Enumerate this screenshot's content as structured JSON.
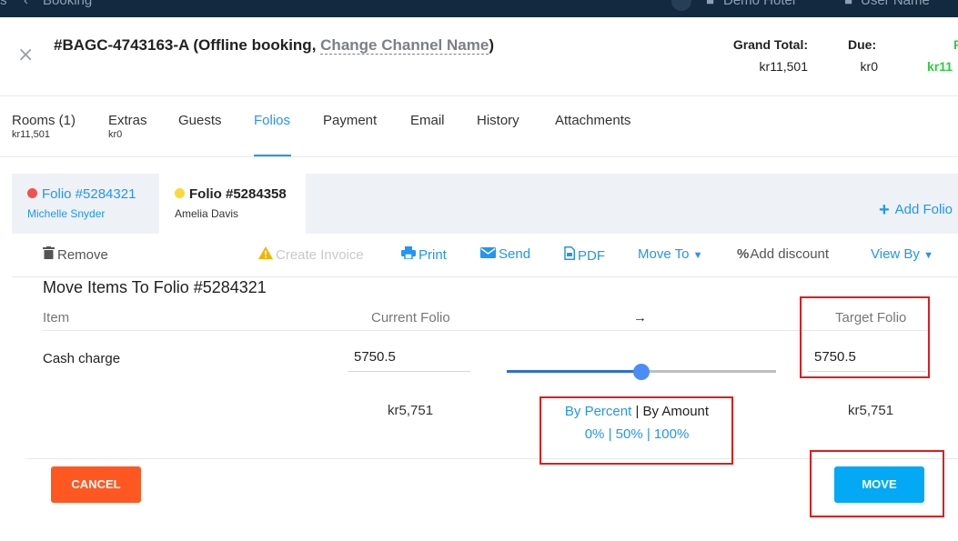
{
  "topbar": {
    "left_fragment": "s",
    "back_label": "Booking",
    "hotel_name": "Demo Hotel",
    "user_name": "User Name"
  },
  "booking": {
    "title_prefix": "#BAGC-4743163-A (Offline booking, ",
    "change_channel": "Change Channel Name",
    "title_suffix": ")",
    "grand_total_label": "Grand Total:",
    "grand_total_value": "kr11,501",
    "due_label": "Due:",
    "due_value": "kr0",
    "paid_label": "P",
    "paid_value": "kr11"
  },
  "tabs": [
    {
      "label": "Rooms (1)",
      "sub": "kr11,501"
    },
    {
      "label": "Extras",
      "sub": "kr0"
    },
    {
      "label": "Guests"
    },
    {
      "label": "Folios"
    },
    {
      "label": "Payment"
    },
    {
      "label": "Email"
    },
    {
      "label": "History"
    },
    {
      "label": "Attachments"
    }
  ],
  "folios": [
    {
      "name": "Folio #5284321",
      "guest": "Michelle Snyder",
      "dot_color": "#ef5350"
    },
    {
      "name": "Folio #5284358",
      "guest": "Amelia Davis",
      "dot_color": "#fdd835"
    }
  ],
  "add_folio_label": "Add Folio",
  "toolbar": {
    "remove": "Remove",
    "create_invoice": "Create Invoice",
    "print": "Print",
    "send": "Send",
    "pdf": "PDF",
    "move_to": "Move To",
    "add_discount": "Add discount",
    "view_by": "View By"
  },
  "move_dialog": {
    "title": "Move Items To Folio #5284321",
    "col_item": "Item",
    "col_current": "Current Folio",
    "arrow": "→",
    "col_target": "Target Folio",
    "item_name": "Cash charge",
    "current_value": "5750.5",
    "target_value": "5750.5",
    "slider_percent": 50,
    "current_total": "kr5,751",
    "target_total": "kr5,751",
    "by_percent": "By Percent",
    "separator": "|",
    "by_amount": "By Amount",
    "pct_0": "0%",
    "pct_50": "50%",
    "pct_100": "100%",
    "cancel_label": "CANCEL",
    "move_label": "MOVE"
  },
  "colors": {
    "accent": "#2196f3",
    "cancel": "#ff5722",
    "move": "#03a9f4",
    "highlight": "#e21b1b",
    "paid": "#2ecc40"
  }
}
